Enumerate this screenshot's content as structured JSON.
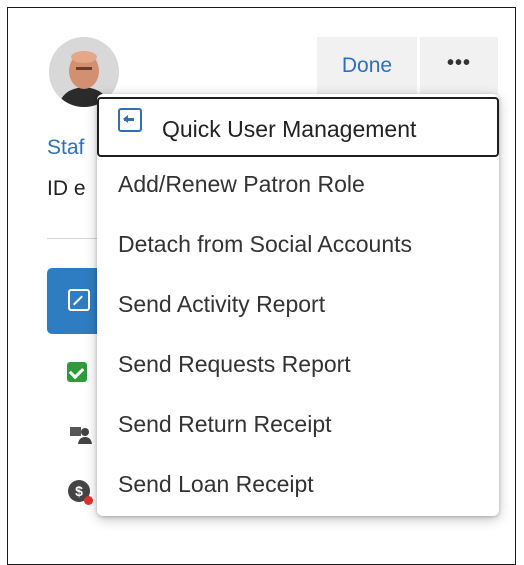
{
  "header": {
    "staff_link_text": "Staf",
    "id_text": "ID e",
    "done_label": "Done",
    "more_label": "•••"
  },
  "menu": {
    "items": [
      {
        "label": "Quick User Management",
        "icon": "quick-user-management-icon",
        "selected": true
      },
      {
        "label": "Add/Renew Patron Role"
      },
      {
        "label": "Detach from Social Accounts"
      },
      {
        "label": "Send Activity Report"
      },
      {
        "label": "Send Requests Report"
      },
      {
        "label": "Send Return Receipt"
      },
      {
        "label": "Send Loan Receipt"
      }
    ]
  },
  "sidebar": {
    "icons": [
      "external-link-icon",
      "check-icon",
      "people-icon",
      "money-icon"
    ]
  },
  "colors": {
    "accent": "#2e7dc2",
    "link": "#2c6fbf",
    "success": "#2e9b3a",
    "alert": "#e0312a"
  }
}
